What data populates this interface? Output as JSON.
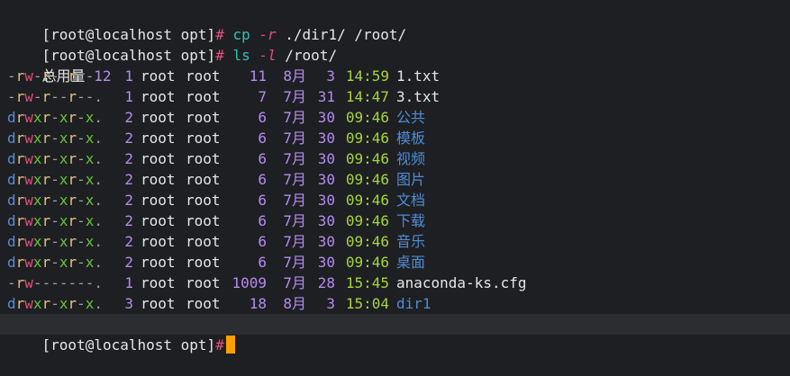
{
  "terminal": {
    "prompt": {
      "user_host_dir": "[root@localhost opt]",
      "symbol": "#"
    },
    "lines": [
      {
        "cmd": "cp",
        "opt": "-r",
        "args": "./dir1/ /root/"
      },
      {
        "cmd": "ls",
        "opt": "-l",
        "args": "/root/"
      }
    ],
    "total": {
      "label": "总用量",
      "value": "12"
    },
    "entries": [
      {
        "perm": "-rw-r--r--.",
        "links": "1",
        "owner": "root",
        "group": "root",
        "size": "11",
        "month": "8月",
        "day": "3",
        "time": "14:59",
        "name": "1.txt",
        "type": "file"
      },
      {
        "perm": "-rw-r--r--.",
        "links": "1",
        "owner": "root",
        "group": "root",
        "size": "7",
        "month": "7月",
        "day": "31",
        "time": "14:47",
        "name": "3.txt",
        "type": "file"
      },
      {
        "perm": "drwxr-xr-x.",
        "links": "2",
        "owner": "root",
        "group": "root",
        "size": "6",
        "month": "7月",
        "day": "30",
        "time": "09:46",
        "name": "公共",
        "type": "dir"
      },
      {
        "perm": "drwxr-xr-x.",
        "links": "2",
        "owner": "root",
        "group": "root",
        "size": "6",
        "month": "7月",
        "day": "30",
        "time": "09:46",
        "name": "模板",
        "type": "dir"
      },
      {
        "perm": "drwxr-xr-x.",
        "links": "2",
        "owner": "root",
        "group": "root",
        "size": "6",
        "month": "7月",
        "day": "30",
        "time": "09:46",
        "name": "视频",
        "type": "dir"
      },
      {
        "perm": "drwxr-xr-x.",
        "links": "2",
        "owner": "root",
        "group": "root",
        "size": "6",
        "month": "7月",
        "day": "30",
        "time": "09:46",
        "name": "图片",
        "type": "dir"
      },
      {
        "perm": "drwxr-xr-x.",
        "links": "2",
        "owner": "root",
        "group": "root",
        "size": "6",
        "month": "7月",
        "day": "30",
        "time": "09:46",
        "name": "文档",
        "type": "dir"
      },
      {
        "perm": "drwxr-xr-x.",
        "links": "2",
        "owner": "root",
        "group": "root",
        "size": "6",
        "month": "7月",
        "day": "30",
        "time": "09:46",
        "name": "下载",
        "type": "dir"
      },
      {
        "perm": "drwxr-xr-x.",
        "links": "2",
        "owner": "root",
        "group": "root",
        "size": "6",
        "month": "7月",
        "day": "30",
        "time": "09:46",
        "name": "音乐",
        "type": "dir"
      },
      {
        "perm": "drwxr-xr-x.",
        "links": "2",
        "owner": "root",
        "group": "root",
        "size": "6",
        "month": "7月",
        "day": "30",
        "time": "09:46",
        "name": "桌面",
        "type": "dir"
      },
      {
        "perm": "-rw-------.",
        "links": "1",
        "owner": "root",
        "group": "root",
        "size": "1009",
        "month": "7月",
        "day": "28",
        "time": "15:45",
        "name": "anaconda-ks.cfg",
        "type": "file"
      },
      {
        "perm": "drwxr-xr-x.",
        "links": "3",
        "owner": "root",
        "group": "root",
        "size": "18",
        "month": "8月",
        "day": "3",
        "time": "15:04",
        "name": "dir1",
        "type": "dir"
      }
    ],
    "colors": {
      "background": "#1e1f22",
      "current_line": "#2c2d31",
      "cursor": "#ffa000",
      "command": "#2ec4b6",
      "time": "#a6d53d",
      "directory": "#4f8cd6"
    }
  }
}
